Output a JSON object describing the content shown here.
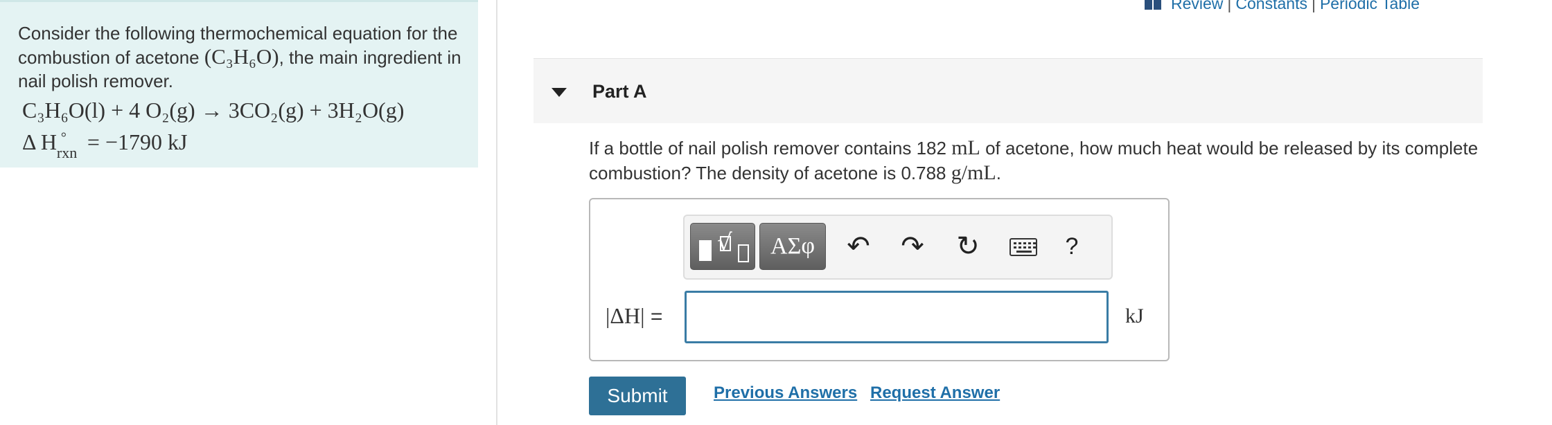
{
  "intro": {
    "text_1": "Consider the following thermochemical equation for the combustion of acetone ",
    "formula": "(C₃H₆O)",
    "text_2": ", the main ingredient in nail polish remover.",
    "equation": {
      "reactant_1": "C₃H₆O(l)",
      "plus_1": " + ",
      "reactant_2": "4 O₂(g)",
      "arrow": " → ",
      "product_1": "3CO₂(g)",
      "plus_2": " + ",
      "product_2": "3H₂O(g)"
    },
    "enthalpy": {
      "symbol": "Δ H",
      "degree": "°",
      "subscript": "rxn",
      "value": "= −1790 kJ"
    }
  },
  "toplinks": {
    "review": "Review",
    "sep_1": "|",
    "constants": "Constants",
    "sep_2": "|",
    "periodic": "Periodic Table"
  },
  "part": {
    "title": "Part A"
  },
  "question": {
    "text_1": "If a bottle of nail polish remover contains 182 ",
    "volume_unit": "mL",
    "text_2": " of acetone, how much heat would be released by its complete combustion? The density of acetone is 0.788 ",
    "density_unit": "g/mL",
    "text_3": "."
  },
  "toolbar": {
    "greek_label": "ΑΣφ",
    "undo_glyph": "↶",
    "redo_glyph": "↷",
    "reset_glyph": "↻",
    "help_label": "?"
  },
  "answer": {
    "label": "|ΔH|",
    "equals": " =",
    "value": "",
    "unit": "kJ"
  },
  "actions": {
    "submit": "Submit",
    "previous_answers": "Previous Answers",
    "request_answer": "Request Answer"
  },
  "colors": {
    "intro_bg": "#e4f3f3",
    "link": "#1f6fa8",
    "submit_bg": "#2e7096",
    "input_border": "#3a7ca5"
  },
  "icons": [
    "book-icon",
    "template-icon",
    "undo-icon",
    "redo-icon",
    "reset-icon",
    "keyboard-icon",
    "help-icon",
    "caret-down-icon"
  ]
}
